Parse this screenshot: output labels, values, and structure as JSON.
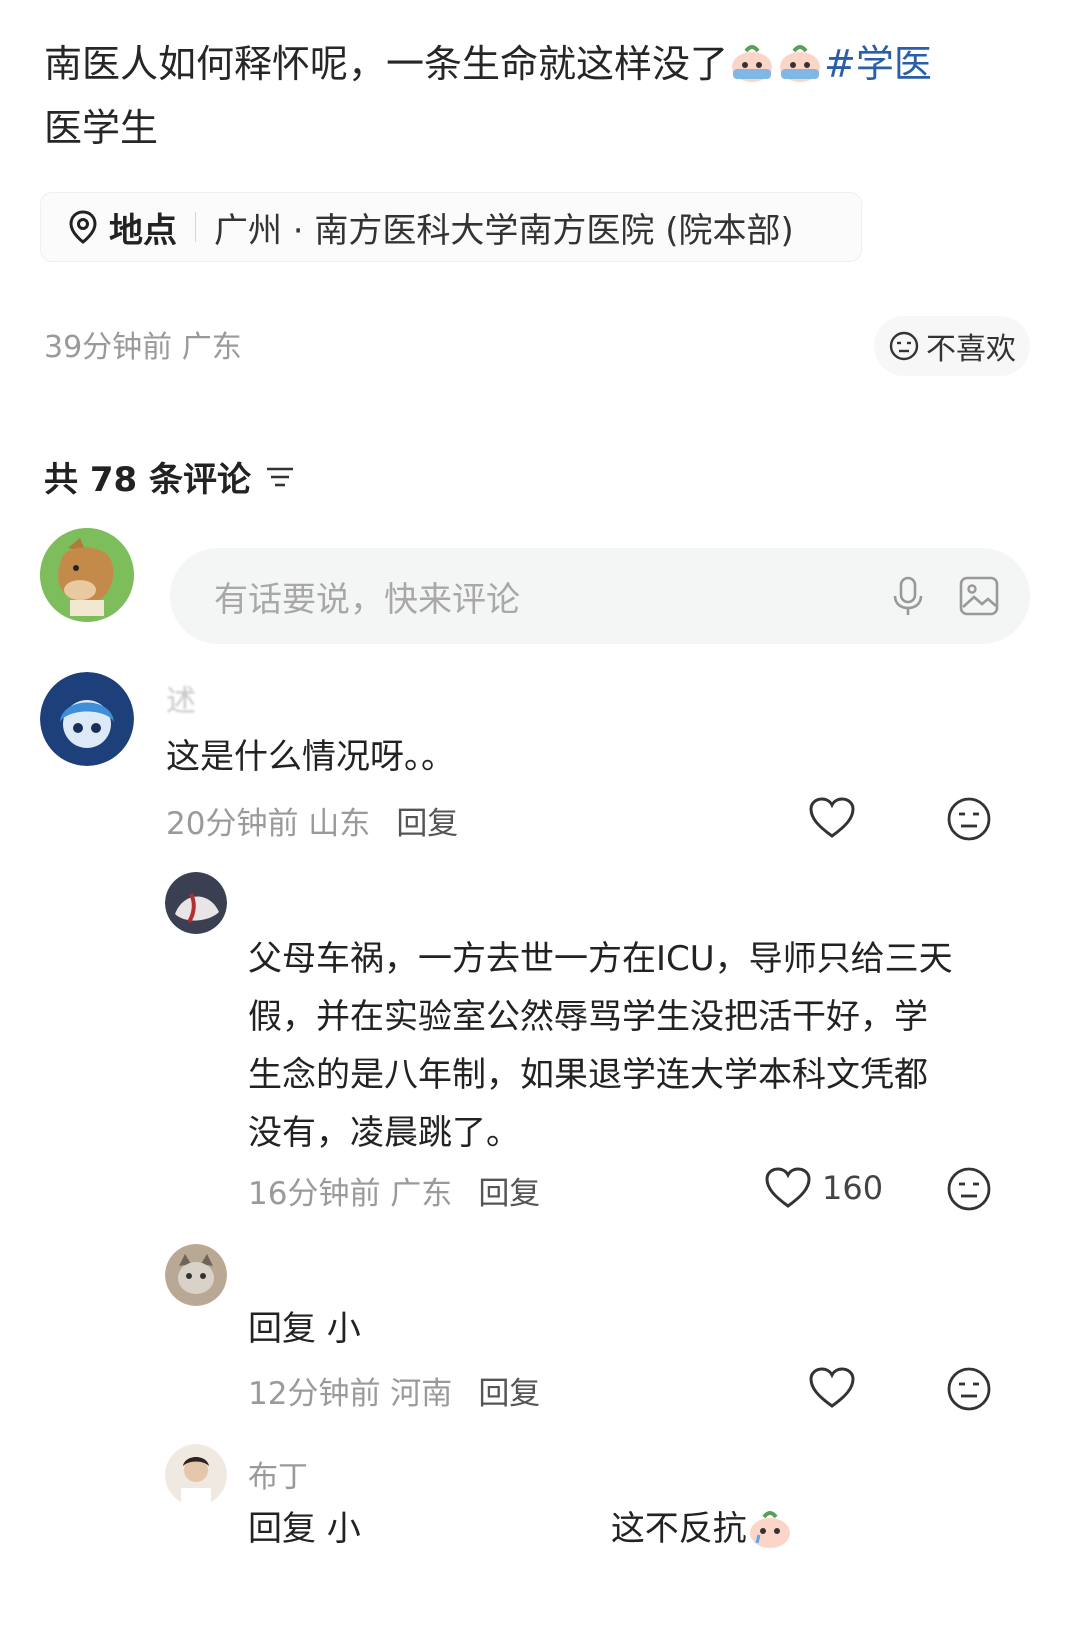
{
  "post": {
    "title_text": "南医人如何释怀呢，一条生命就这样没了",
    "hashtag_1": "#学医",
    "hashtag_2": "医学生",
    "location_label": "地点",
    "location_value": "广州 · 南方医科大学南方医院 (院本部)",
    "time_region": "39分钟前 广东",
    "dislike_label": "不喜欢"
  },
  "comments_header": {
    "count_text": "共 78 条评论"
  },
  "comment_input": {
    "placeholder": "有话要说，快来评论"
  },
  "comments": [
    {
      "username": "述",
      "text": "这是什么情况呀。。",
      "meta": "20分钟前 山东",
      "reply_label": "回复"
    },
    {
      "username": "",
      "text_lines": [
        "父母车祸，一方去世一方在ICU，导师只给三天",
        "假，并在实验室公然辱骂学生没把活干好，学",
        "生念的是八年制，如果退学连大学本科文凭都",
        "没有，凌晨跳了。"
      ],
      "meta": "16分钟前 广东",
      "reply_label": "回复",
      "likes": "160"
    },
    {
      "username": "",
      "text": "回复 小",
      "meta": "12分钟前 河南",
      "reply_label": "回复"
    },
    {
      "username": "布丁",
      "text_prefix": "回复 小",
      "text_suffix": "这不反抗"
    }
  ],
  "colors": {
    "hashtag": "#2a5fa8",
    "muted": "#9a9a9a",
    "input_bg": "#f4f5f5"
  },
  "icons": [
    "location-pin-icon",
    "neutral-face-icon",
    "filter-icon",
    "microphone-icon",
    "image-icon",
    "heart-icon",
    "crying-face-emoji"
  ]
}
